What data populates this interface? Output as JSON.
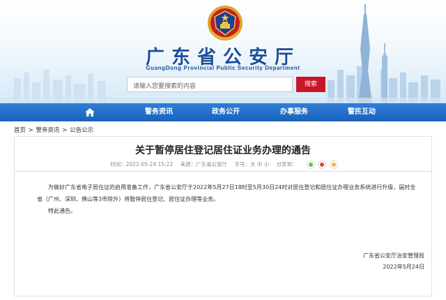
{
  "header": {
    "title": "广东省公安厅",
    "subtitle": "GuangDong Provincial Public Security Department",
    "search_placeholder": "请输入您要搜索的内容",
    "search_button": "搜索"
  },
  "nav": {
    "home_icon": "home-icon",
    "items": [
      {
        "label": "警务资讯"
      },
      {
        "label": "政务公开"
      },
      {
        "label": "办事服务"
      },
      {
        "label": "警民互动"
      }
    ]
  },
  "breadcrumb": {
    "home": "首页",
    "sep1": " > ",
    "level1": "警务资讯",
    "sep2": " > ",
    "level2": "公告公示"
  },
  "article": {
    "title": "关于暂停居住登记居住证业务办理的通告",
    "time_label": "时间：2022-05-24 15:22",
    "source_label": "来源：广东省公安厅",
    "fontsize_label": "字号：大 中 小",
    "share_label": "分享到：",
    "share_icons": [
      "wechat-icon",
      "weibo-icon",
      "qzone-icon"
    ],
    "paragraph1": "为做好广东省电子居住证的启用准备工作，广东省公安厅于2022年5月27日18时至5月30日24时对居住登记和居住证办理业务系统进行升级，届时全省（广州、深圳、佛山等3市除外）将暂停居住登记、居住证办理等业务。",
    "paragraph2": "特此通告。",
    "signature": "广东省公安厅治安管理局",
    "date": "2022年5月24日"
  },
  "colors": {
    "brand_blue": "#1b4f9c",
    "nav_blue": "#1f67c0",
    "search_red": "#c8152a"
  }
}
